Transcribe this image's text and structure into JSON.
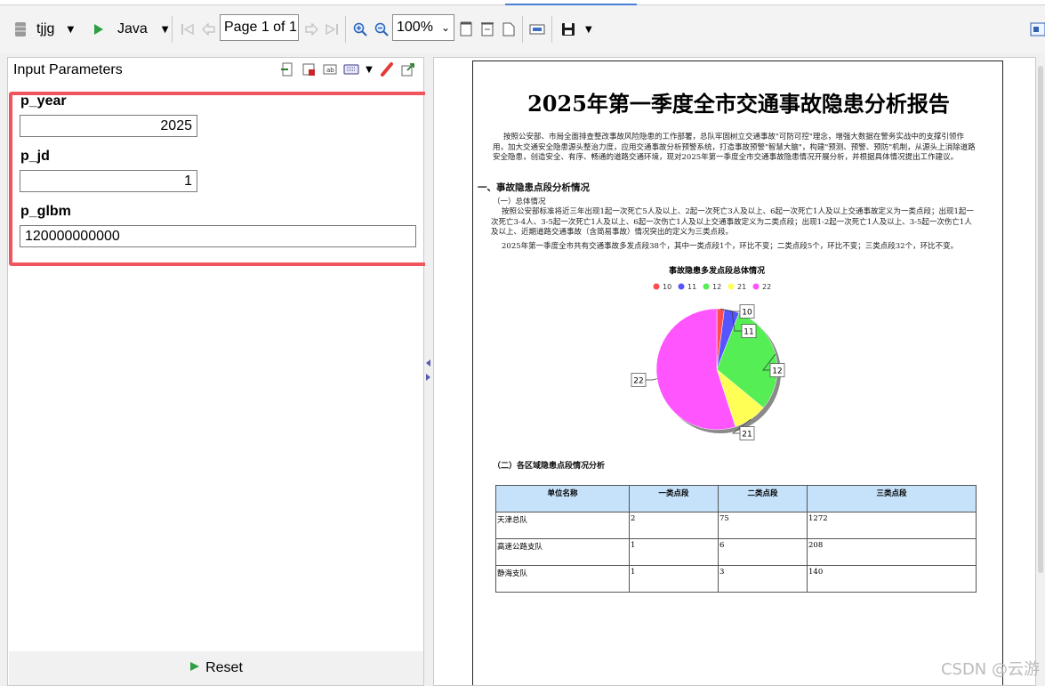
{
  "toolbar": {
    "report_name": "tjjg",
    "run_label": "Java",
    "page_text": "Page 1 of 1",
    "zoom": "100%"
  },
  "params_panel": {
    "title": "Input Parameters",
    "params": [
      {
        "name": "p_year",
        "value": "2025"
      },
      {
        "name": "p_jd",
        "value": "1"
      },
      {
        "name": "p_glbm",
        "value": "120000000000"
      }
    ],
    "reset_label": "Reset"
  },
  "report": {
    "title": "2025年第一季度全市交通事故隐患分析报告",
    "intro": "按照公安部、市局全面排查整改事故风险隐患的工作部署，总队牢固树立交通事故\"可防可控\"理念，增强大数据在警务实战中的支撑引领作用，加大交通安全隐患源头整治力度，应用交通事故分析预警系统，打造事故预警\"智慧大脑\"，构建\"预测、预警、预防\"机制，从源头上消除道路安全隐患，创造安全、有序、畅通的道路交通环境，现对2025年第一季度全市交通事故隐患情况开展分析，并根据具体情况提出工作建议。",
    "section1": "一、事故隐患点段分析情况",
    "sub1": "（一）总体情况",
    "para1": "按照公安部标准将近三年出现1起一次死亡5人及以上、2起一次死亡3人及以上、6起一次死亡1人及以上交通事故定义为一类点段；出现1起一次死亡3-4人、3-5起一次死亡1人及以上、6起一次伤亡1人及以上交通事故定义为二类点段；出现1-2起一次死亡1人及以上、3-5起一次伤亡1人及以上、近期道路交通事故（含简易事故）情况突出的定义为三类点段。",
    "para2": "2025年第一季度全市共有交通事故多发点段38个，其中一类点段1个，环比不变；二类点段5个，环比不变；三类点段32个，环比不变。",
    "sub2": "（二）各区域隐患点段情况分析",
    "table": {
      "headers": [
        "单位名称",
        "一类点段",
        "二类点段",
        "三类点段"
      ],
      "rows": [
        [
          "天津总队",
          "2",
          "75",
          "1272"
        ],
        [
          "高速公路支队",
          "1",
          "6",
          "208"
        ],
        [
          "静海支队",
          "1",
          "3",
          "140"
        ]
      ]
    }
  },
  "chart_data": {
    "type": "pie",
    "title": "事故隐患多发点段总体情况",
    "categories": [
      "10",
      "11",
      "12",
      "21",
      "22"
    ],
    "values": [
      2.0,
      4.0,
      30.0,
      9.0,
      55.0
    ],
    "colors": [
      "#ff4d4d",
      "#5555ff",
      "#55ee55",
      "#ffff55",
      "#ff55ff"
    ],
    "legend": "top"
  },
  "watermark": "CSDN @云游"
}
